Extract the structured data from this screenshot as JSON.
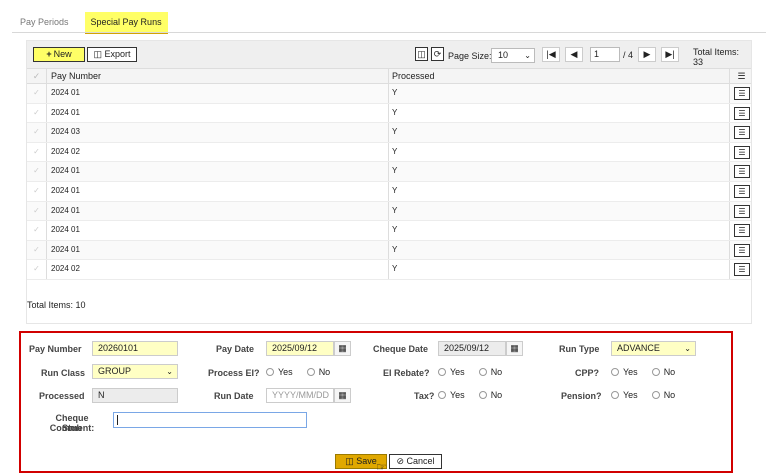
{
  "tabs": [
    {
      "label": "Pay Periods",
      "active": false
    },
    {
      "label": "Special Pay Runs",
      "active": true
    }
  ],
  "toolbar": {
    "new_label": "New",
    "export_label": "Export",
    "page_size_label": "Page Size:",
    "page_size_value": "10",
    "current_page": "1",
    "page_of": "/ 4",
    "total_items": "Total Items: 33"
  },
  "grid": {
    "columns": [
      "Pay Number",
      "Processed"
    ],
    "rows": [
      {
        "pay_number": "2024 01",
        "processed": "Y"
      },
      {
        "pay_number": "2024 01",
        "processed": "Y"
      },
      {
        "pay_number": "2024 03",
        "processed": "Y"
      },
      {
        "pay_number": "2024 02",
        "processed": "Y"
      },
      {
        "pay_number": "2024 01",
        "processed": "Y"
      },
      {
        "pay_number": "2024 01",
        "processed": "Y"
      },
      {
        "pay_number": "2024 01",
        "processed": "Y"
      },
      {
        "pay_number": "2024 01",
        "processed": "Y"
      },
      {
        "pay_number": "2024 01",
        "processed": "Y"
      },
      {
        "pay_number": "2024 02",
        "processed": "Y"
      }
    ],
    "total_items": "Total Items: 10"
  },
  "form": {
    "pay_number_label": "Pay Number",
    "pay_number_value": "20260101",
    "pay_date_label": "Pay Date",
    "pay_date_value": "2025/09/12",
    "cheque_date_label": "Cheque Date",
    "cheque_date_value": "2025/09/12",
    "run_type_label": "Run Type",
    "run_type_value": "ADVANCE",
    "run_class_label": "Run Class",
    "run_class_value": "GROUP",
    "process_ei_label": "Process EI?",
    "ei_rebate_label": "EI Rebate?",
    "cpp_label": "CPP?",
    "processed_label": "Processed",
    "processed_value": "N",
    "run_date_label": "Run Date",
    "run_date_placeholder": "YYYY/MM/DD",
    "tax_label": "Tax?",
    "pension_label": "Pension?",
    "yes_label": "Yes",
    "no_label": "No",
    "cheque_stub_label_1": "Cheque Stub",
    "cheque_stub_label_2": "Comment:",
    "save_label": "Save",
    "cancel_label": "Cancel"
  },
  "icons": {
    "calendar": "calendar-icon",
    "export": "export-icon",
    "save": "save-icon",
    "cancel": "cancel-icon",
    "refresh": "refresh-icon",
    "row_menu": "list-icon"
  },
  "colors": {
    "accent_yellow": "#ffff66",
    "save_gold": "#e0a800",
    "form_border": "#d10000"
  }
}
